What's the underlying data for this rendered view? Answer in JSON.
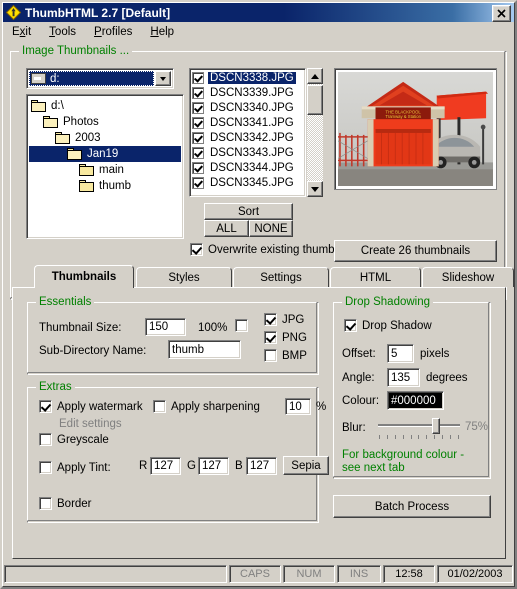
{
  "window": {
    "title": "ThumbHTML 2.7  [Default]",
    "app_icon": "diamond-logo-icon",
    "close_label": "✕"
  },
  "menu": [
    {
      "label": "Exit",
      "accel": "x"
    },
    {
      "label": "Tools",
      "accel": "T"
    },
    {
      "label": "Profiles",
      "accel": "P"
    },
    {
      "label": "Help",
      "accel": "H"
    }
  ],
  "image_thumbnails": {
    "group_label": "Image Thumbnails ...",
    "drive_combo": {
      "value": "d:",
      "icon": "drive-icon"
    },
    "tree": [
      {
        "label": "d:\\",
        "depth": 0,
        "selected": false
      },
      {
        "label": "Photos",
        "depth": 1,
        "selected": false
      },
      {
        "label": "2003",
        "depth": 2,
        "selected": false
      },
      {
        "label": "Jan19",
        "depth": 3,
        "selected": true
      },
      {
        "label": "main",
        "depth": 4,
        "selected": false
      },
      {
        "label": "thumb",
        "depth": 4,
        "selected": false
      }
    ],
    "files": [
      {
        "name": "DSCN3338.JPG",
        "checked": true,
        "selected": true
      },
      {
        "name": "DSCN3339.JPG",
        "checked": true,
        "selected": false
      },
      {
        "name": "DSCN3340.JPG",
        "checked": true,
        "selected": false
      },
      {
        "name": "DSCN3341.JPG",
        "checked": true,
        "selected": false
      },
      {
        "name": "DSCN3342.JPG",
        "checked": true,
        "selected": false
      },
      {
        "name": "DSCN3343.JPG",
        "checked": true,
        "selected": false
      },
      {
        "name": "DSCN3344.JPG",
        "checked": true,
        "selected": false
      },
      {
        "name": "DSCN3345.JPG",
        "checked": true,
        "selected": false
      }
    ],
    "sort_label": "Sort",
    "all_label": "ALL",
    "none_label": "NONE",
    "overwrite": {
      "label": "Overwrite existing thumbnails",
      "checked": true
    },
    "create_button": "Create 26 thumbnails"
  },
  "tabs": [
    {
      "label": "Thumbnails",
      "active": true
    },
    {
      "label": "Styles",
      "active": false
    },
    {
      "label": "Settings",
      "active": false
    },
    {
      "label": "HTML",
      "active": false
    },
    {
      "label": "Slideshow",
      "active": false
    }
  ],
  "essentials": {
    "group_label": "Essentials",
    "thumbnail_size_label": "Thumbnail Size:",
    "thumbnail_size_value": "150",
    "hundred_percent_label": "100%",
    "hundred_percent_checked": false,
    "subdir_label": "Sub-Directory Name:",
    "subdir_value": "thumb",
    "formats": [
      {
        "label": "JPG",
        "checked": true
      },
      {
        "label": "PNG",
        "checked": true
      },
      {
        "label": "BMP",
        "checked": false
      }
    ]
  },
  "extras": {
    "group_label": "Extras",
    "watermark": {
      "label": "Apply watermark",
      "checked": true
    },
    "edit_settings_label": "Edit settings",
    "sharpening": {
      "label": "Apply sharpening",
      "checked": false,
      "value": "10",
      "unit": "%"
    },
    "greyscale": {
      "label": "Greyscale",
      "checked": false
    },
    "tint": {
      "label": "Apply Tint:",
      "checked": false,
      "r_label": "R",
      "r_value": "127",
      "g_label": "G",
      "g_value": "127",
      "b_label": "B",
      "b_value": "127",
      "sepia_label": "Sepia"
    },
    "border": {
      "label": "Border",
      "checked": false
    }
  },
  "drop_shadowing": {
    "group_label": "Drop Shadowing",
    "drop_shadow": {
      "label": "Drop Shadow",
      "checked": true
    },
    "offset_label": "Offset:",
    "offset_value": "5",
    "offset_unit": "pixels",
    "angle_label": "Angle:",
    "angle_value": "135",
    "angle_unit": "degrees",
    "colour_label": "Colour:",
    "colour_value": "#000000",
    "blur_label": "Blur:",
    "blur_value": "75%",
    "blur_percent": 75,
    "note_line1": "For background colour -",
    "note_line2": "see next tab",
    "batch_button": "Batch Process"
  },
  "status_bar": {
    "message": "",
    "caps": "CAPS",
    "num": "NUM",
    "ins": "INS",
    "time": "12:58",
    "date": "01/02/2003"
  },
  "colors": {
    "face": "#d4d0c8",
    "title_active": "#0a246a",
    "group_label": "#008000",
    "selection": "#0a246a"
  }
}
